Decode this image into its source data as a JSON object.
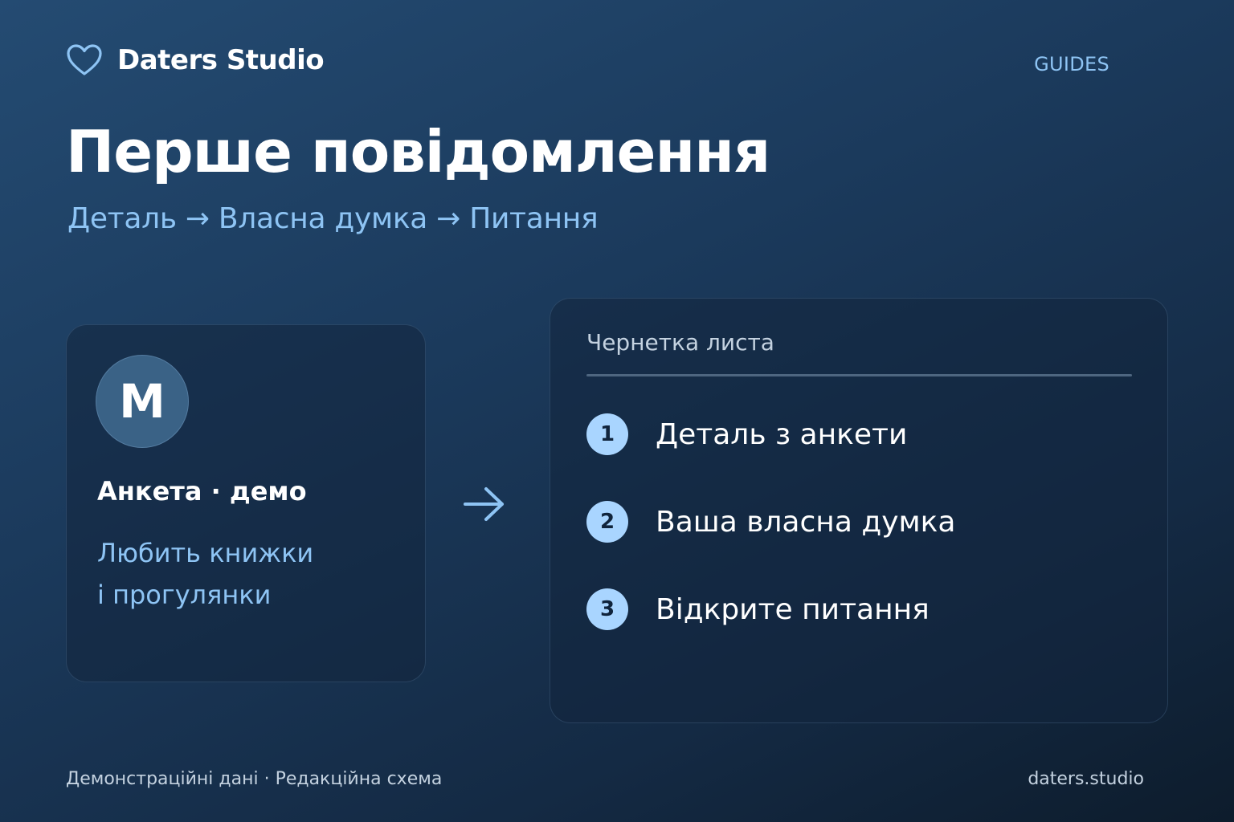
{
  "header": {
    "brand_icon": "heart-icon",
    "brand_name": "Daters Studio",
    "nav_link": "GUIDES"
  },
  "hero": {
    "title": "Перше повідомлення",
    "subtitle": "Деталь → Власна думка → Питання"
  },
  "profile_card": {
    "avatar_letter": "M",
    "title": "Анкета · демо",
    "description_line1": "Любить книжки",
    "description_line2": "і прогулянки"
  },
  "flow_arrow_icon": "arrow-right-icon",
  "draft_card": {
    "title": "Чернетка листа",
    "steps": [
      {
        "number": "1",
        "text": "Деталь з анкети"
      },
      {
        "number": "2",
        "text": "Ваша власна думка"
      },
      {
        "number": "3",
        "text": "Відкрите питання"
      }
    ]
  },
  "footer": {
    "left": "Демонстраційні дані · Редакційна схема",
    "right": "daters.studio"
  },
  "colors": {
    "accent": "#8ec4f4",
    "step_badge": "#a9d5ff",
    "background_top": "#244b72",
    "background_bottom": "#0d1c2c"
  }
}
